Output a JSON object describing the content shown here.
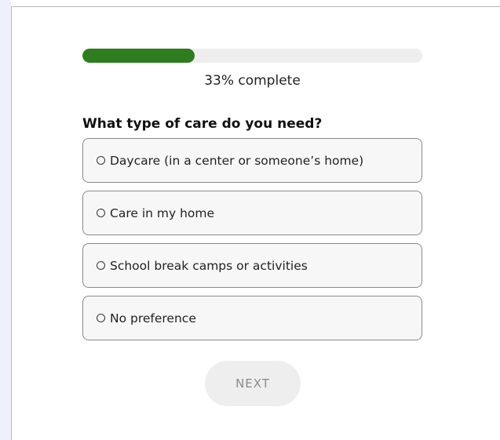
{
  "progress": {
    "percent": 33,
    "label": "33% complete",
    "fill_color": "#2e7d1f",
    "track_color": "#eeeeee"
  },
  "question": {
    "title": "What type of care do you need?"
  },
  "options": [
    {
      "label": "Daycare (in a center or someone’s home)",
      "selected": false
    },
    {
      "label": "Care in my home",
      "selected": false
    },
    {
      "label": "School break camps or activities",
      "selected": false
    },
    {
      "label": "No preference",
      "selected": false
    }
  ],
  "actions": {
    "next_label": "NEXT",
    "next_enabled": false
  }
}
